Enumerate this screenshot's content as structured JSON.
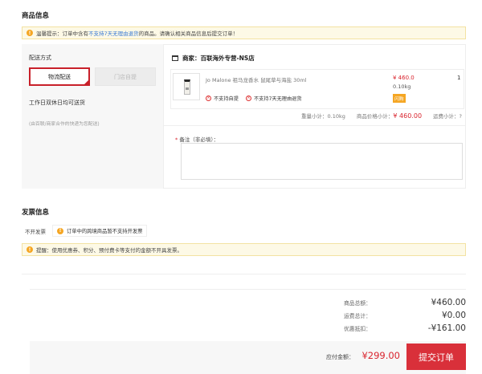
{
  "product_section": {
    "title": "商品信息"
  },
  "notice": {
    "prefix": "温馨提示：订单中含有",
    "highlight": "不支持7天无理由退货",
    "suffix": "的商品。请确认相关商品信息后提交订单！"
  },
  "shipping": {
    "label": "配送方式",
    "options": [
      {
        "label": "物流配送",
        "selected": true
      },
      {
        "label": "门店自提",
        "disabled": true
      }
    ],
    "time": "工作日双休日均可送货",
    "note": "(由百联/商家合作的快递为您配送)"
  },
  "store": {
    "name": "商家：百联海外专营-NS店"
  },
  "item": {
    "name": "Jo Malone 祖马龙香水 鼠尾草与海盐 30ml",
    "price": "¥ 460.0",
    "weight": "0.10kg",
    "badge": "闪购",
    "qty": "1",
    "tags": [
      "不支持自提",
      "不支持7天无理由退货"
    ]
  },
  "subtotals": {
    "weight": "重量小计：0.10kg",
    "price_label": "商品价格小计：",
    "price_value": "¥ 460.00",
    "freight": "运费小计：?"
  },
  "remark": {
    "star": "*",
    "label": "备注（非必填）："
  },
  "invoice": {
    "title": "发票信息",
    "none_label": "不开发票",
    "chip": "订单中的跨境商品暂不支持开发票",
    "tip": "提醒：使用优惠券、积分、预付费卡等支付的金额不开具发票。"
  },
  "summary": {
    "rows": [
      {
        "label": "商品总额：",
        "value": "¥460.00"
      },
      {
        "label": "运费总计：",
        "value": "¥0.00"
      },
      {
        "label": "优惠抵扣：",
        "value": "-¥161.00"
      }
    ],
    "payable_label": "应付金额：",
    "payable_value": "¥299.00",
    "submit": "提交订单"
  },
  "colors": {
    "accent": "#d9232d",
    "warning": "#f5a623",
    "notice_bg": "#fdf9e6",
    "link": "#3a7bd5"
  }
}
